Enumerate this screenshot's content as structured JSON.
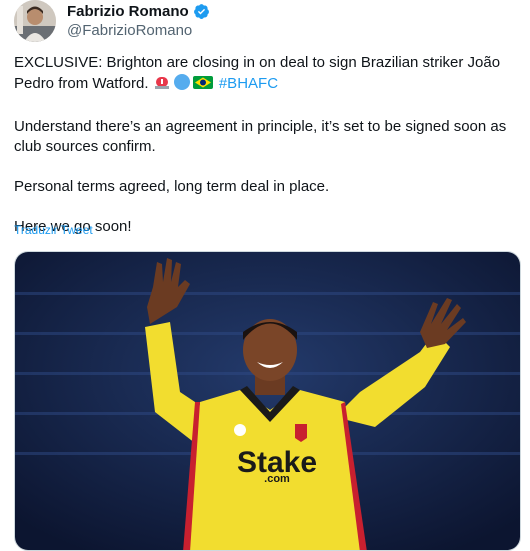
{
  "author": {
    "display_name": "Fabrizio Romano",
    "handle": "@FabrizioRomano",
    "verified_icon": "verified-badge-icon"
  },
  "tweet": {
    "line1": "EXCLUSIVE: Brighton are closing in on deal to sign Brazilian striker João",
    "line2_text": "Pedro from Watford.",
    "emojis": [
      "siren-emoji",
      "blue-circle-emoji",
      "brazil-flag-emoji"
    ],
    "hashtag": "#BHAFC",
    "para2": "Understand there’s an agreement in principle, it’s set to be signed soon as club sources confirm.",
    "para3": "Personal terms agreed, long term deal in place.",
    "para4": "Here we go soon!"
  },
  "translate_link": "Traduzir Tweet",
  "media": {
    "sponsor_text": "Stake",
    "sponsor_sub": ".com"
  },
  "colors": {
    "link": "#1d9bf0",
    "text": "#0f1419",
    "secondary": "#536471",
    "jersey_yellow": "#f2dd2f"
  }
}
